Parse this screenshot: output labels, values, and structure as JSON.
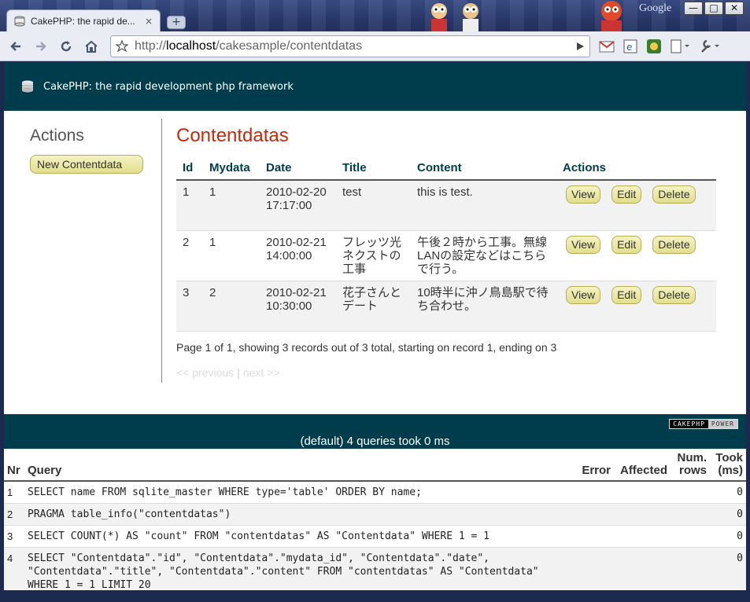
{
  "browser": {
    "tab_title": "CakePHP: the rapid de...",
    "tab_close": "×",
    "new_tab": "+",
    "google_label": "Google",
    "url_prefix": "http://",
    "url_host": "localhost",
    "url_path": "/cakesample/contentdatas",
    "window_buttons": [
      "—",
      "□",
      "✕"
    ]
  },
  "header": {
    "site_title": "CakePHP: the rapid development php framework"
  },
  "sidebar": {
    "heading": "Actions",
    "new_button": "New Contentdata"
  },
  "main": {
    "heading": "Contentdatas",
    "columns": [
      "Id",
      "Mydata",
      "Date",
      "Title",
      "Content",
      "Actions"
    ],
    "rows": [
      {
        "id": "1",
        "mydata": "1",
        "date": "2010-02-20 17:17:00",
        "title": "test",
        "content": "this is test."
      },
      {
        "id": "2",
        "mydata": "1",
        "date": "2010-02-21 14:00:00",
        "title": "フレッツ光ネクストの工事",
        "content": "午後２時から工事。無線LANの設定などはこちらで行う。"
      },
      {
        "id": "3",
        "mydata": "2",
        "date": "2010-02-21 10:30:00",
        "title": "花子さんとデート",
        "content": "10時半に沖ノ鳥島駅で待ち合わせ。"
      }
    ],
    "action_labels": {
      "view": "View",
      "edit": "Edit",
      "delete": "Delete"
    },
    "paging_info": "Page 1 of 1, showing 3 records out of 3 total, starting on record 1, ending on 3",
    "prev_label": "<< previous",
    "separator": "|",
    "next_label": "next >>"
  },
  "footer": {
    "powered_left": "CAKEPHP",
    "powered_right": "POWER",
    "sql_caption": "(default) 4 queries took 0 ms",
    "sql_columns": [
      "Nr",
      "Query",
      "Error",
      "Affected",
      "Num. rows",
      "Took (ms)"
    ],
    "sql_rows": [
      {
        "nr": "1",
        "query": "SELECT name FROM sqlite_master WHERE type='table' ORDER BY name;",
        "error": "",
        "affected": "",
        "num_rows": "",
        "took": "0"
      },
      {
        "nr": "2",
        "query": "PRAGMA table_info(\"contentdatas\")",
        "error": "",
        "affected": "",
        "num_rows": "",
        "took": "0"
      },
      {
        "nr": "3",
        "query": "SELECT COUNT(*) AS \"count\" FROM \"contentdatas\" AS \"Contentdata\" WHERE 1 = 1",
        "error": "",
        "affected": "",
        "num_rows": "",
        "took": "0"
      },
      {
        "nr": "4",
        "query": "SELECT \"Contentdata\".\"id\", \"Contentdata\".\"mydata_id\", \"Contentdata\".\"date\", \"Contentdata\".\"title\", \"Contentdata\".\"content\" FROM \"contentdatas\" AS \"Contentdata\" WHERE 1 = 1 LIMIT 20",
        "error": "",
        "affected": "",
        "num_rows": "",
        "took": "0"
      }
    ]
  }
}
